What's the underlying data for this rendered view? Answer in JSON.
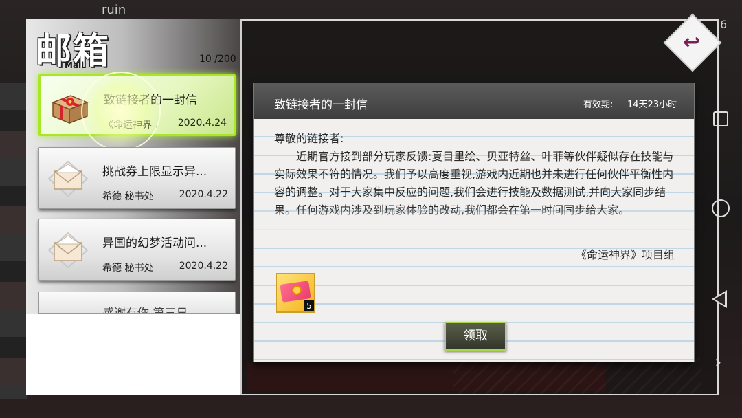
{
  "background": {
    "player_name": "ruin",
    "right_number": "6"
  },
  "header": {
    "title": "邮箱",
    "subtitle": "Mail",
    "count": "10 /200"
  },
  "mail_list": [
    {
      "title": "致链接者的一封信",
      "sender": "《命运神界 .",
      "date": "2020.4.24",
      "icon": "gift-box-icon",
      "selected": true
    },
    {
      "title": "挑战券上限显示异...",
      "sender": "希德 秘书处",
      "date": "2020.4.22",
      "icon": "envelope-icon",
      "selected": false
    },
    {
      "title": "异国的幻梦活动问...",
      "sender": "希德 秘书处",
      "date": "2020.4.22",
      "icon": "envelope-icon",
      "selected": false
    },
    {
      "title": "感谢有你 第三日",
      "sender": "",
      "date": "",
      "icon": "envelope-icon",
      "selected": false
    }
  ],
  "detail": {
    "title": "致链接者的一封信",
    "validity_label": "有效期:",
    "validity_value": "14天23小时",
    "greeting": "尊敬的链接者:",
    "paragraph": "近期官方接到部分玩家反馈:夏目里绘、贝亚特丝、叶菲等伙伴疑似存在技能与实际效果不符的情况。我们予以高度重视,游戏内近期也并未进行任何伙伴平衡性内容的调整。对于大家集中反应的问题,我们会进行技能及数据测试,并向大家同步结果。任何游戏内涉及到玩家体验的改动,我们都会在第一时间同步给大家。",
    "signature": "《命运神界》项目组",
    "attachment_count": "5",
    "claim_label": "领取"
  },
  "colors": {
    "accent_green": "#a8e62a",
    "header_dark": "#4a4a4a",
    "back_arrow": "#7a1f5a"
  }
}
